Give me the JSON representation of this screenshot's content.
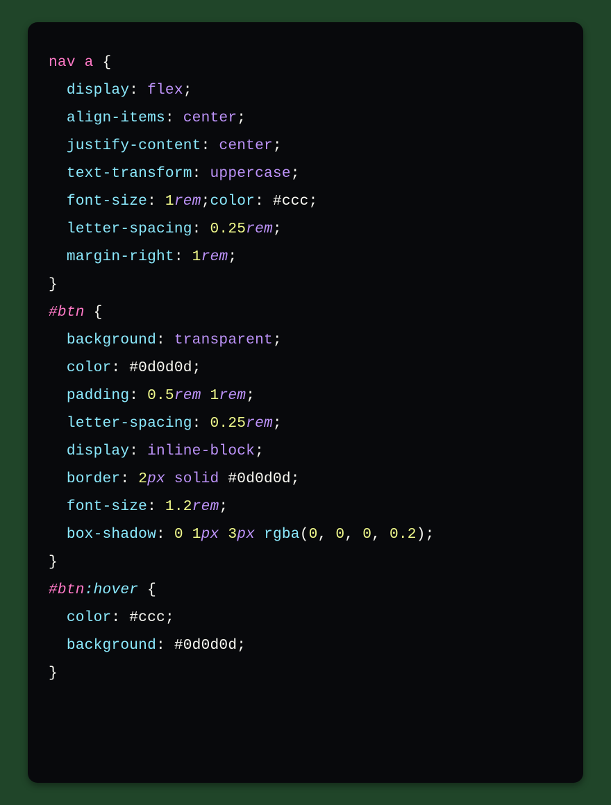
{
  "lines": {
    "l1_tag": "nav",
    "l1_sp": " ",
    "l1_tag2": "a",
    "l1_sp2": " ",
    "l1_brace": "{",
    "l2_ind": "  ",
    "l2_prop": "display",
    "l2_colon": ":",
    "l2_sp": " ",
    "l2_val": "flex",
    "l2_semi": ";",
    "l3_ind": "  ",
    "l3_prop": "align-items",
    "l3_colon": ":",
    "l3_sp": " ",
    "l3_val": "center",
    "l3_semi": ";",
    "l4_ind": "  ",
    "l4_prop": "justify-content",
    "l4_colon": ":",
    "l4_sp": " ",
    "l4_val": "center",
    "l4_semi": ";",
    "l5_ind": "  ",
    "l5_prop": "text-transform",
    "l5_colon": ":",
    "l5_sp": " ",
    "l5_val": "uppercase",
    "l5_semi": ";",
    "l6_ind": "  ",
    "l6_prop1": "font-size",
    "l6_colon1": ":",
    "l6_sp1": " ",
    "l6_num1": "1",
    "l6_unit1": "rem",
    "l6_semi1": ";",
    "l6_prop2": "color",
    "l6_colon2": ":",
    "l6_sp2": " ",
    "l6_val2": "#ccc",
    "l6_semi2": ";",
    "l7_ind": "  ",
    "l7_prop": "letter-spacing",
    "l7_colon": ":",
    "l7_sp": " ",
    "l7_num": "0.25",
    "l7_unit": "rem",
    "l7_semi": ";",
    "l8_ind": "  ",
    "l8_prop": "margin-right",
    "l8_colon": ":",
    "l8_sp": " ",
    "l8_num": "1",
    "l8_unit": "rem",
    "l8_semi": ";",
    "l9_brace": "}",
    "l10_sel": "#btn",
    "l10_sp": " ",
    "l10_brace": "{",
    "l11_ind": "  ",
    "l11_prop": "background",
    "l11_colon": ":",
    "l11_sp": " ",
    "l11_val": "transparent",
    "l11_semi": ";",
    "l12_ind": "  ",
    "l12_prop": "color",
    "l12_colon": ":",
    "l12_sp": " ",
    "l12_val": "#0d0d0d",
    "l12_semi": ";",
    "l13_ind": "  ",
    "l13_prop": "padding",
    "l13_colon": ":",
    "l13_sp": " ",
    "l13_num1": "0.5",
    "l13_unit1": "rem",
    "l13_sp2": " ",
    "l13_num2": "1",
    "l13_unit2": "rem",
    "l13_semi": ";",
    "l14_ind": "  ",
    "l14_prop": "letter-spacing",
    "l14_colon": ":",
    "l14_sp": " ",
    "l14_num": "0.25",
    "l14_unit": "rem",
    "l14_semi": ";",
    "l15_ind": "  ",
    "l15_prop": "display",
    "l15_colon": ":",
    "l15_sp": " ",
    "l15_val": "inline-block",
    "l15_semi": ";",
    "l16_ind": "  ",
    "l16_prop": "border",
    "l16_colon": ":",
    "l16_sp": " ",
    "l16_num": "2",
    "l16_unit": "px",
    "l16_sp2": " ",
    "l16_val1": "solid",
    "l16_sp3": " ",
    "l16_val2": "#0d0d0d",
    "l16_semi": ";",
    "l17_ind": "  ",
    "l17_prop": "font-size",
    "l17_colon": ":",
    "l17_sp": " ",
    "l17_num": "1.2",
    "l17_unit": "rem",
    "l17_semi": ";",
    "l18_ind": "  ",
    "l18_prop": "box-shadow",
    "l18_colon": ":",
    "l18_sp": " ",
    "l18_num1": "0",
    "l18_sp2": " ",
    "l18_num2": "1",
    "l18_unit2": "px",
    "l18_sp3": " ",
    "l18_num3": "3",
    "l18_unit3": "px",
    "l18_sp4": " ",
    "l18_func": "rgba",
    "l18_lp": "(",
    "l18_a1": "0",
    "l18_c1": ",",
    "l18_s1": " ",
    "l18_a2": "0",
    "l18_c2": ",",
    "l18_s2": " ",
    "l18_a3": "0",
    "l18_c3": ",",
    "l18_s3": " ",
    "l18_a4": "0.2",
    "l18_rp": ")",
    "l18_semi": ";",
    "l19_brace": "}",
    "l20_sel": "#btn",
    "l20_pseudo": ":hover",
    "l20_sp": " ",
    "l20_brace": "{",
    "l21_ind": "  ",
    "l21_prop": "color",
    "l21_colon": ":",
    "l21_sp": " ",
    "l21_val": "#ccc",
    "l21_semi": ";",
    "l22_ind": "  ",
    "l22_prop": "background",
    "l22_colon": ":",
    "l22_sp": " ",
    "l22_val": "#0d0d0d",
    "l22_semi": ";",
    "l23_brace": "}"
  }
}
